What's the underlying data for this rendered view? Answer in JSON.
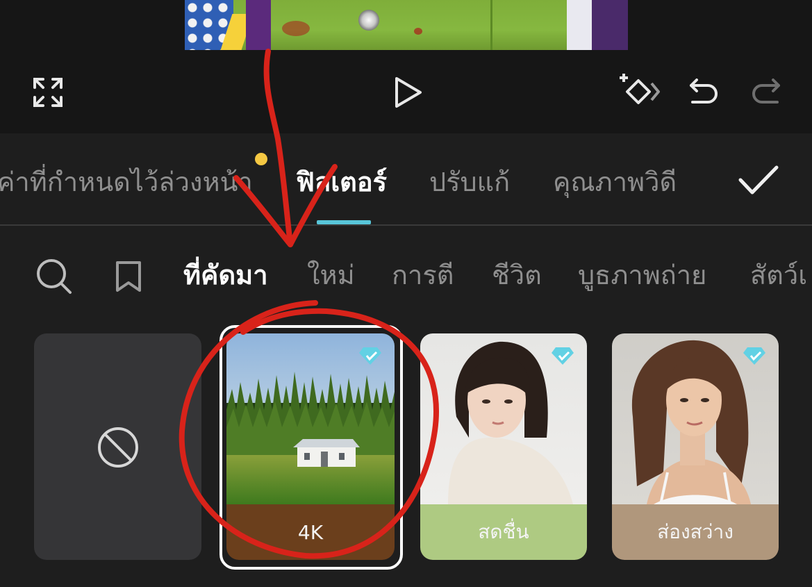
{
  "toolbar": {
    "fullscreen_icon": "fullscreen-icon",
    "play_icon": "play-icon",
    "keyframe_icon": "add-keyframe-icon",
    "undo_icon": "undo-icon",
    "redo_icon": "redo-icon"
  },
  "tabs": [
    {
      "label": "ค่าที่กำหนดไว้ล่วงหน้า",
      "active": false,
      "has_dot": true
    },
    {
      "label": "ฟิลเตอร์",
      "active": true
    },
    {
      "label": "ปรับแก้",
      "active": false
    },
    {
      "label": "คุณภาพวิดี",
      "active": false
    }
  ],
  "confirm_icon": "checkmark-icon",
  "categories": {
    "search_icon": "search-icon",
    "bookmark_icon": "bookmark-icon",
    "items": [
      {
        "label": "ที่คัดมา",
        "active": true
      },
      {
        "label": "ใหม่",
        "active": false
      },
      {
        "label": "การตี",
        "active": false
      },
      {
        "label": "ชีวิต",
        "active": false
      },
      {
        "label": "บูธภาพถ่าย",
        "active": false
      },
      {
        "label": "สัตว์เ",
        "active": false
      }
    ]
  },
  "filters": [
    {
      "label": "",
      "icon": "no-filter-icon",
      "selected": false
    },
    {
      "label": "4K",
      "selected": true,
      "pro": true,
      "label_bg": "#6b3f1c"
    },
    {
      "label": "สดชื่น",
      "selected": false,
      "pro": true,
      "label_bg": "#aeca82"
    },
    {
      "label": "ส่องสว่าง",
      "selected": false,
      "pro": true,
      "label_bg": "#b0977c"
    }
  ],
  "colors": {
    "accent_underline": "#58c6d9",
    "notify_dot": "#f5c843",
    "annotation_red": "#d8231a",
    "pro_badge": "#62d1e4"
  }
}
